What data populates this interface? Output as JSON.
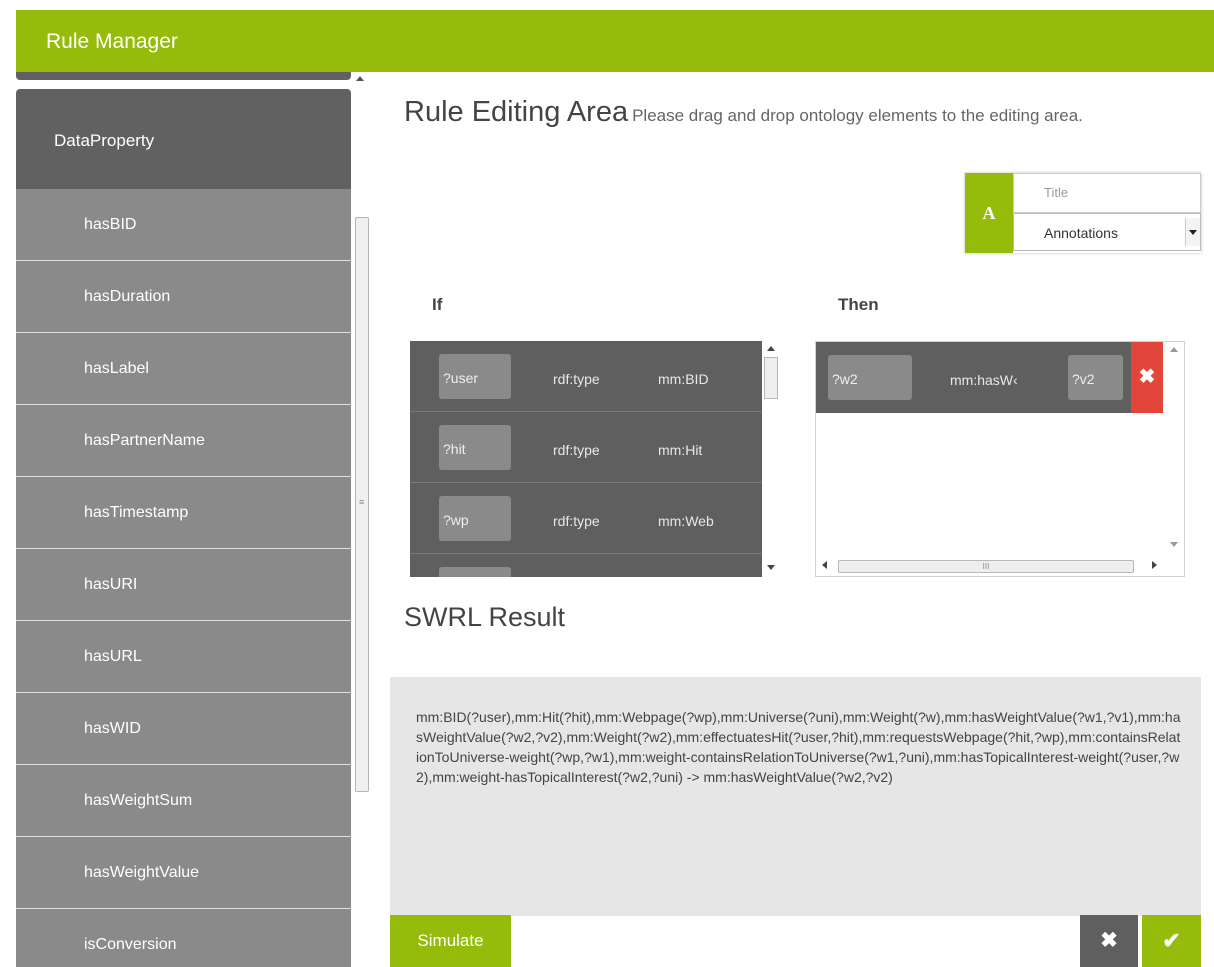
{
  "app": {
    "title": "Rule Manager"
  },
  "sidebar": {
    "header": "DataProperty",
    "items": [
      {
        "label": "hasBID"
      },
      {
        "label": "hasDuration"
      },
      {
        "label": "hasLabel"
      },
      {
        "label": "hasPartnerName"
      },
      {
        "label": "hasTimestamp"
      },
      {
        "label": "hasURI"
      },
      {
        "label": "hasURL"
      },
      {
        "label": "hasWID"
      },
      {
        "label": "hasWeightSum"
      },
      {
        "label": "hasWeightValue"
      },
      {
        "label": "isConversion"
      }
    ]
  },
  "editor": {
    "heading": "Rule Editing Area",
    "hint": "Please drag and drop ontology elements to the editing area.",
    "annotation": {
      "letter": "A",
      "title_placeholder": "Title",
      "select_value": "Annotations"
    },
    "if_label": "If",
    "then_label": "Then",
    "if_atoms": [
      {
        "var": "?user",
        "pred": "rdf:type",
        "obj": "mm:BID"
      },
      {
        "var": "?hit",
        "pred": "rdf:type",
        "obj": "mm:Hit"
      },
      {
        "var": "?wp",
        "pred": "rdf:type",
        "obj": "mm:Web"
      }
    ],
    "then_atom": {
      "var": "?w2",
      "pred": "mm:hasW‹",
      "obj": "?v2",
      "delete_icon": "close-icon"
    }
  },
  "swrl": {
    "title": "SWRL Result",
    "text": "mm:BID(?user),mm:Hit(?hit),mm:Webpage(?wp),mm:Universe(?uni),mm:Weight(?w),mm:hasWeightValue(?w1,?v1),mm:hasWeightValue(?w2,?v2),mm:Weight(?w2),mm:effectuatesHit(?user,?hit),mm:requestsWebpage(?hit,?wp),mm:containsRelationToUniverse-weight(?wp,?w1),mm:weight-containsRelationToUniverse(?w1,?uni),mm:hasTopicalInterest-weight(?user,?w2),mm:weight-hasTopicalInterest(?w2,?uni) -> mm:hasWeightValue(?w2,?v2)"
  },
  "actions": {
    "simulate": "Simulate",
    "cancel_icon": "close-icon",
    "confirm_icon": "check-icon"
  },
  "colors": {
    "accent": "#95bc0b",
    "dark": "#5f5f5f",
    "item": "#8a8a8a",
    "danger": "#e2463a"
  }
}
